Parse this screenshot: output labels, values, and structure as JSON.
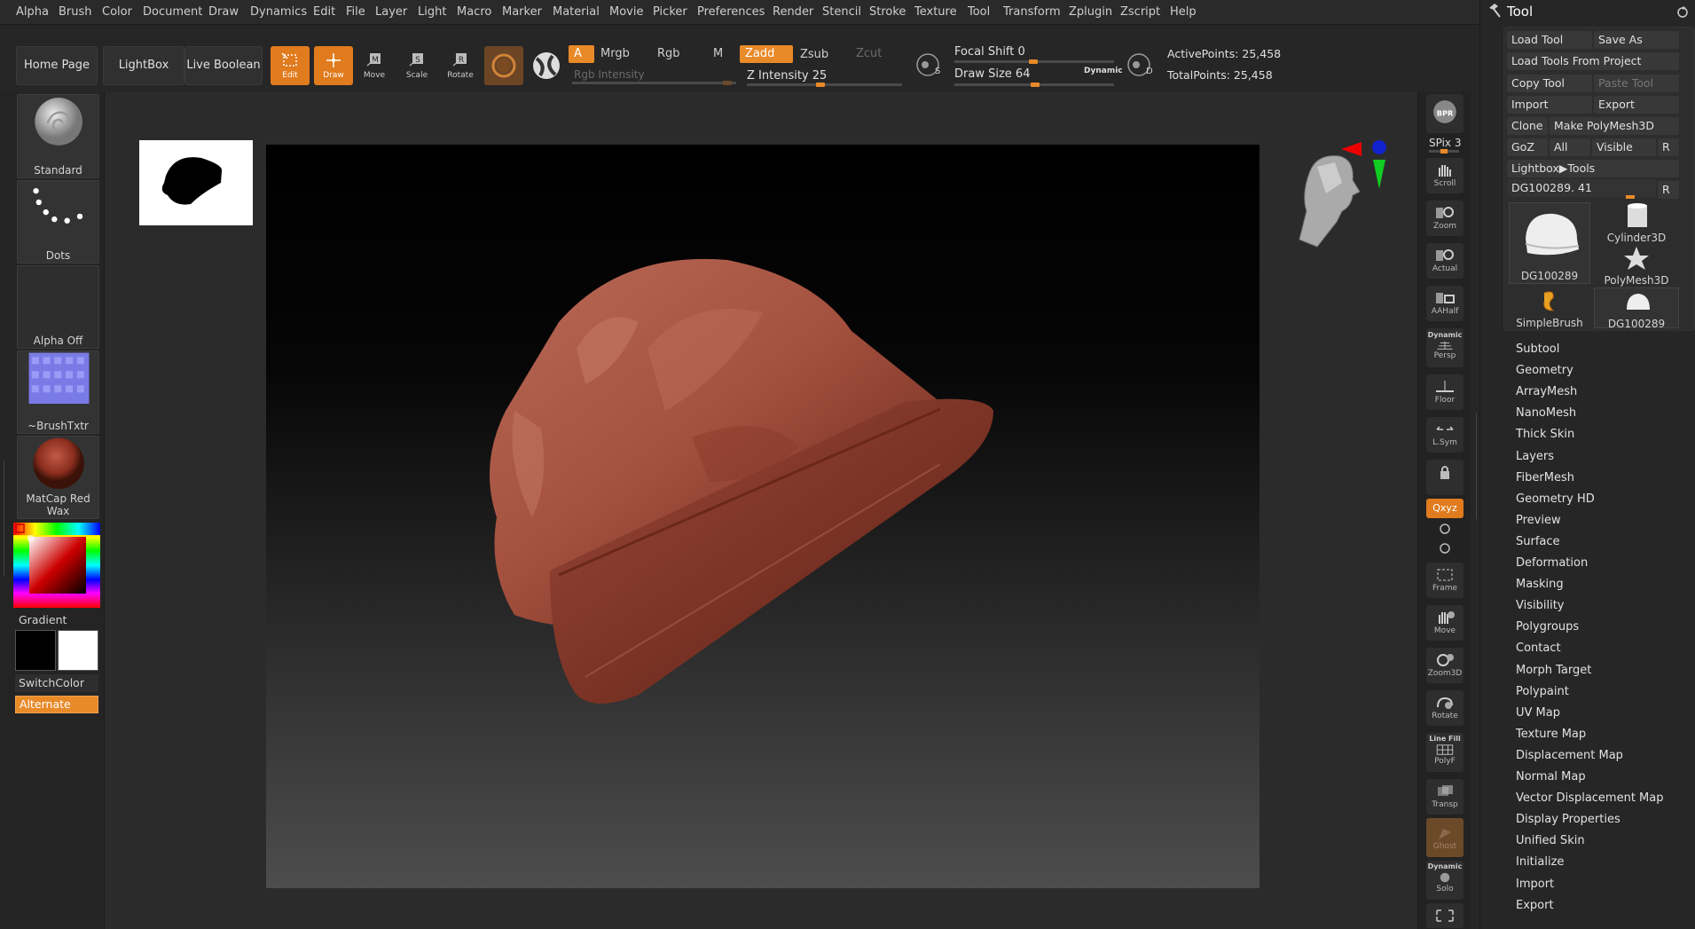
{
  "menu": [
    "Alpha",
    "Brush",
    "Color",
    "Document",
    "Draw",
    "Dynamics",
    "Edit",
    "File",
    "Layer",
    "Light",
    "Macro",
    "Marker",
    "Material",
    "Movie",
    "Picker",
    "Preferences",
    "Render",
    "Stencil",
    "Stroke",
    "Texture",
    "Tool",
    "Transform",
    "Zplugin",
    "Zscript",
    "Help"
  ],
  "toolbar": {
    "home_page": "Home Page",
    "lightbox": "LightBox",
    "live_boolean": "Live Boolean",
    "edit": "Edit",
    "draw": "Draw",
    "move": "Move",
    "scale": "Scale",
    "rotate": "Rotate",
    "a_label": "A",
    "mrgb": "Mrgb",
    "rgb": "Rgb",
    "m": "M",
    "zadd": "Zadd",
    "zsub": "Zsub",
    "zcut": "Zcut",
    "rgb_intensity": "Rgb Intensity",
    "z_intensity_label": "Z Intensity",
    "z_intensity_value": "25",
    "z_intensity_level": 0.25,
    "focal_shift_label": "Focal Shift",
    "focal_shift_value": "0",
    "draw_size_label": "Draw Size",
    "draw_size_value": "64",
    "dynamic": "Dynamic",
    "active_points": "ActivePoints: 25,458",
    "total_points": "TotalPoints: 25,458"
  },
  "left_shelf": {
    "brush": "Standard",
    "stroke": "Dots",
    "alpha": "Alpha Off",
    "texture": "~BrushTxtr",
    "material": "MatCap Red Wax",
    "gradient": "Gradient",
    "switch_color": "SwitchColor",
    "alternate": "Alternate",
    "colors": {
      "main": "#000000",
      "secondary": "#ffffff"
    }
  },
  "right_shelf": {
    "bpr": "BPR",
    "spix": "SPix 3",
    "scroll": "Scroll",
    "zoom": "Zoom",
    "actual": "Actual",
    "aahalf": "AAHalf",
    "dynamic": "Dynamic",
    "persp": "Persp",
    "floor": "Floor",
    "lsym": "L.Sym",
    "xyz": "Qxyz",
    "frame": "Frame",
    "move": "Move",
    "zoom3d": "Zoom3D",
    "rotate": "Rotate",
    "line_fill": "Line Fill",
    "polyf": "PolyF",
    "transp": "Transp",
    "ghost": "Ghost",
    "dynamic2": "Dynamic",
    "solo": "Solo"
  },
  "tool_palette": {
    "title": "Tool",
    "load_tool": "Load Tool",
    "save_as": "Save As",
    "load_from_project": "Load Tools From Project",
    "copy_tool": "Copy Tool",
    "paste_tool": "Paste Tool",
    "import": "Import",
    "export": "Export",
    "clone": "Clone",
    "make_polymesh": "Make PolyMesh3D",
    "goz": "GoZ",
    "all": "All",
    "visible": "Visible",
    "r": "R",
    "lightbox_tools": "Lightbox▶Tools",
    "current_tool": "DG100289. 41",
    "thumbs": [
      "DG100289",
      "Cylinder3D",
      "PolyMesh3D",
      "SimpleBrush",
      "DG100289"
    ],
    "subpalettes": [
      "Subtool",
      "Geometry",
      "ArrayMesh",
      "NanoMesh",
      "Thick Skin",
      "Layers",
      "FiberMesh",
      "Geometry HD",
      "Preview",
      "Surface",
      "Deformation",
      "Masking",
      "Visibility",
      "Polygroups",
      "Contact",
      "Morph Target",
      "Polypaint",
      "UV Map",
      "Texture Map",
      "Displacement Map",
      "Normal Map",
      "Vector Displacement Map",
      "Display Properties",
      "Unified Skin",
      "Initialize",
      "Import",
      "Export"
    ]
  }
}
